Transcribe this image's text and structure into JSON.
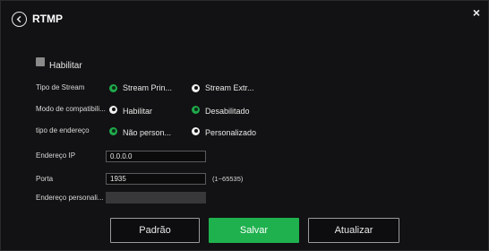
{
  "dialog": {
    "title": "RTMP",
    "close_glyph": "×",
    "back_icon": "chevron-left-circle-icon"
  },
  "enable": {
    "label": "Habilitar",
    "checked": false
  },
  "rows": {
    "stream_type": {
      "label": "Tipo de Stream",
      "options": [
        "Stream Prin...",
        "Stream Extr..."
      ],
      "selected": "Stream Prin..."
    },
    "compat_mode": {
      "label": "Modo de compatibili...",
      "options": [
        "Habilitar",
        "Desabilitado"
      ],
      "selected": "Desabilitado"
    },
    "address_type": {
      "label": "tipo de endereço",
      "options": [
        "Não person...",
        "Personalizado"
      ],
      "selected": "Não person..."
    },
    "ip": {
      "label": "Endereço IP",
      "value": "0.0.0.0"
    },
    "port": {
      "label": "Porta",
      "value": "1935",
      "range": "(1~65535)"
    },
    "custom_address": {
      "label": "Endereço personali...",
      "value": ""
    }
  },
  "buttons": {
    "default": "Padrão",
    "save": "Salvar",
    "refresh": "Atualizar"
  },
  "colors": {
    "accent": "#1fb14e",
    "background": "#121214",
    "text": "#e8e8e8"
  }
}
